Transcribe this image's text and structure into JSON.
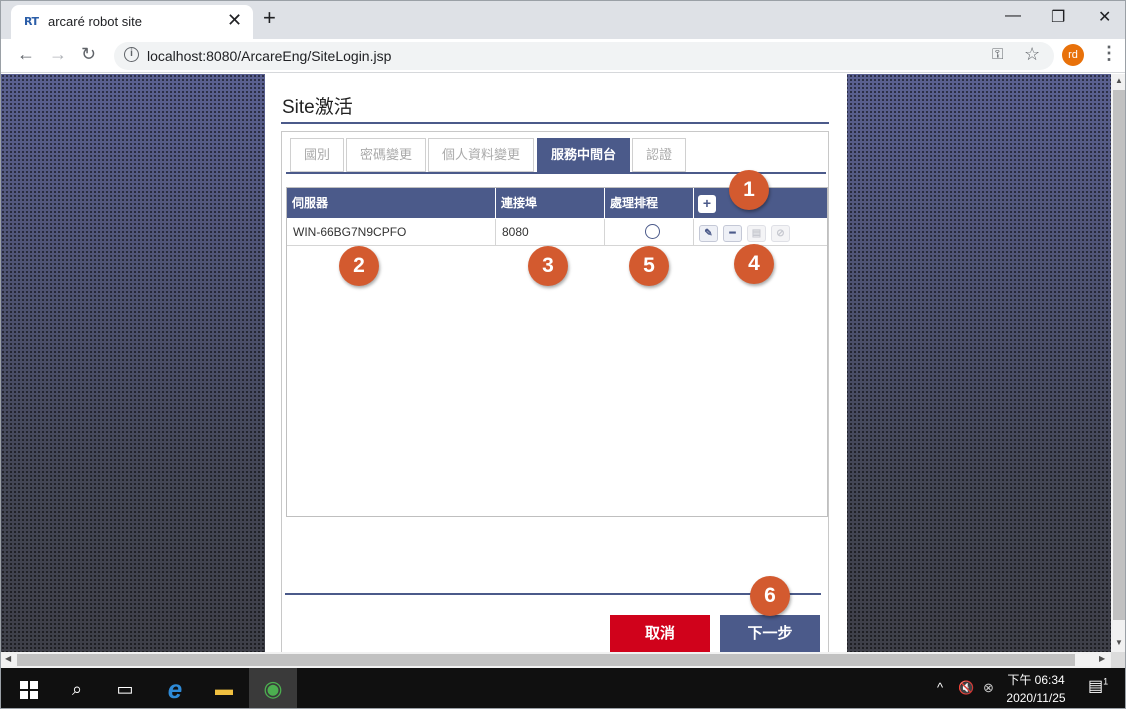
{
  "browser": {
    "tab_favicon": "RT",
    "tab_title": "arcaré robot site",
    "tab_close_icon": "close-icon",
    "new_tab_icon": "plus-icon",
    "url": "localhost:8080/ArcareEng/SiteLogin.jsp",
    "profile_initials": "rd",
    "profile_color": "#e8710a",
    "icons": {
      "back": "←",
      "forward": "→",
      "reload": "↻",
      "key": "⚿",
      "star": "☆",
      "menu": "⋮",
      "minimize": "—",
      "maximize": "❐",
      "close": "✕"
    }
  },
  "page": {
    "title": "Site激活",
    "accent": "#4b5a8a",
    "tabs": [
      {
        "label": "國別",
        "active": false
      },
      {
        "label": "密碼變更",
        "active": false
      },
      {
        "label": "個人資料變更",
        "active": false
      },
      {
        "label": "服務中間台",
        "active": true
      },
      {
        "label": "認證",
        "active": false
      }
    ],
    "grid": {
      "columns": [
        "伺服器",
        "連接埠",
        "處理排程"
      ],
      "add_icon": "+",
      "rows": [
        {
          "server": "WIN-66BG7N9CPFO",
          "port": "8080",
          "schedule_selected": false
        }
      ],
      "row_actions": [
        {
          "icon": "edit-icon",
          "glyph": "✎",
          "enabled": true
        },
        {
          "icon": "remove-icon",
          "glyph": "━",
          "enabled": true
        },
        {
          "icon": "save-icon",
          "glyph": "▤",
          "enabled": false
        },
        {
          "icon": "cancel-icon",
          "glyph": "⊘",
          "enabled": false
        }
      ]
    },
    "buttons": {
      "cancel": "取消",
      "next": "下一步",
      "cancel_color": "#d0021b"
    },
    "markers": [
      "1",
      "2",
      "3",
      "4",
      "5",
      "6"
    ]
  },
  "taskbar": {
    "start_icon": "windows-start-icon",
    "search_icon": "⌕",
    "task_view_icon": "▭",
    "ie_icon": "e",
    "explorer_icon": "▬",
    "chrome_icon": "◉",
    "tray": {
      "chevron": "^",
      "volume": "🔇",
      "network": "⊗",
      "time": "下午 06:34",
      "date": "2020/11/25",
      "notifications": "1"
    }
  }
}
